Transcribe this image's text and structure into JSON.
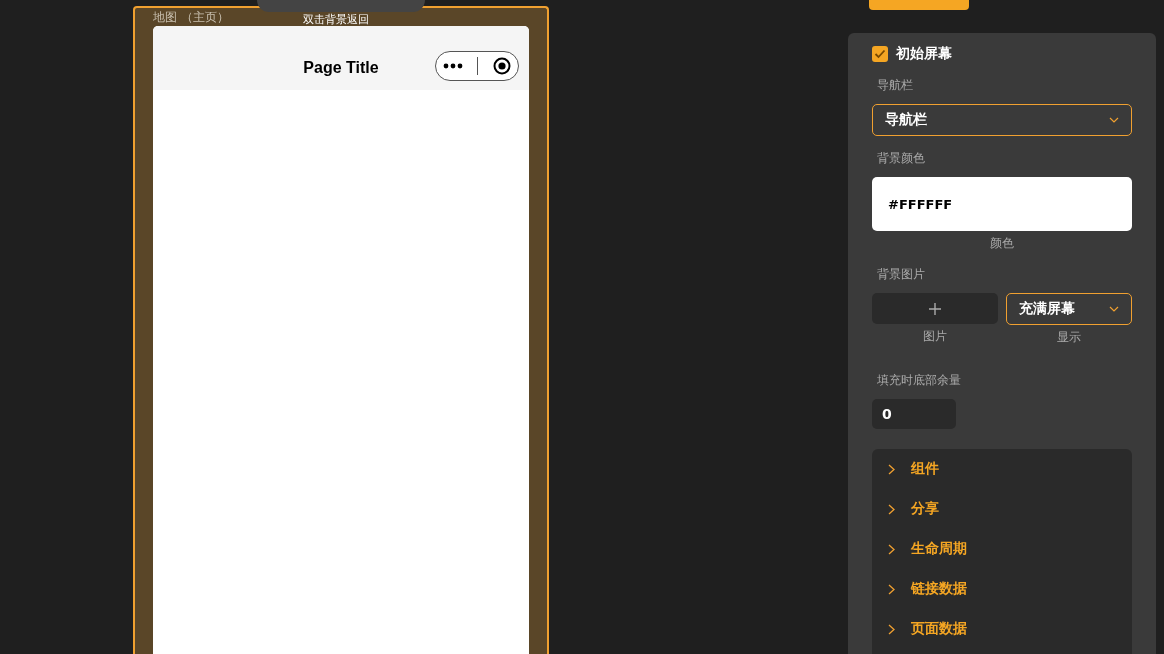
{
  "canvas": {
    "label": "地图 （主页）",
    "hint": "双击背景返回",
    "phone": {
      "title": "Page Title"
    }
  },
  "panel": {
    "initial_screen": {
      "label": "初始屏幕",
      "checked": true
    },
    "nav_label": "导航栏",
    "nav_select": "导航栏",
    "bg_color_label": "背景颜色",
    "bg_color_value": "#FFFFFF",
    "bg_color_caption": "颜色",
    "bg_image_label": "背景图片",
    "image_caption": "图片",
    "display_select": "充满屏幕",
    "display_caption": "显示",
    "bottom_label": "填充时底部余量",
    "bottom_value": "0",
    "sections": [
      {
        "label": "组件",
        "expanded": false
      },
      {
        "label": "分享",
        "expanded": false
      },
      {
        "label": "生命周期",
        "expanded": false
      },
      {
        "label": "链接数据",
        "expanded": false
      },
      {
        "label": "页面数据",
        "expanded": false
      }
    ]
  }
}
